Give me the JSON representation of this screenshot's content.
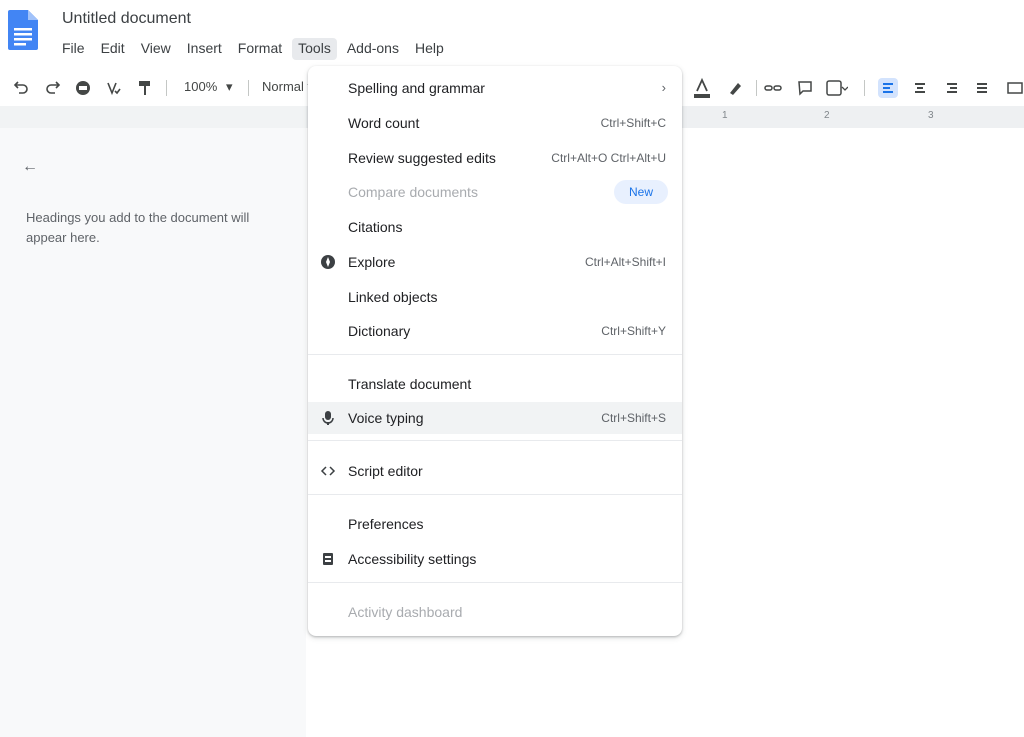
{
  "header": {
    "doc_title": "Untitled document",
    "menus": [
      {
        "label": "File"
      },
      {
        "label": "Edit"
      },
      {
        "label": "View"
      },
      {
        "label": "Insert"
      },
      {
        "label": "Format"
      },
      {
        "label": "Tools"
      },
      {
        "label": "Add-ons"
      },
      {
        "label": "Help"
      }
    ]
  },
  "toolbar": {
    "zoom": "100%",
    "style": "Normal text",
    "arrow": "▾"
  },
  "ruler": {
    "marks": [
      "1",
      "2",
      "3"
    ]
  },
  "sidebar": {
    "back": "←",
    "note": "Headings you add to the document will appear here."
  },
  "tools_menu": {
    "items": [
      {
        "label": "Spelling and grammar",
        "arrow": "›"
      },
      {
        "label": "Word count",
        "shortcut": "Ctrl+Shift+C"
      },
      {
        "label": "Review suggested edits",
        "shortcut": "Ctrl+Alt+O Ctrl+Alt+U"
      },
      {
        "label": "Compare documents",
        "badge": "New"
      },
      {
        "label": "Citations"
      },
      {
        "label": "Explore",
        "shortcut": "Ctrl+Alt+Shift+I"
      },
      {
        "label": "Linked objects"
      },
      {
        "label": "Dictionary",
        "shortcut": "Ctrl+Shift+Y"
      },
      {
        "label": "Translate document"
      },
      {
        "label": "Voice typing",
        "shortcut": "Ctrl+Shift+S"
      },
      {
        "label": "Script editor"
      },
      {
        "label": "Preferences"
      },
      {
        "label": "Accessibility settings"
      },
      {
        "label": "Activity dashboard"
      }
    ]
  },
  "colors": {
    "accent": "#1a73e8",
    "doc_icon": "#4285f4"
  }
}
